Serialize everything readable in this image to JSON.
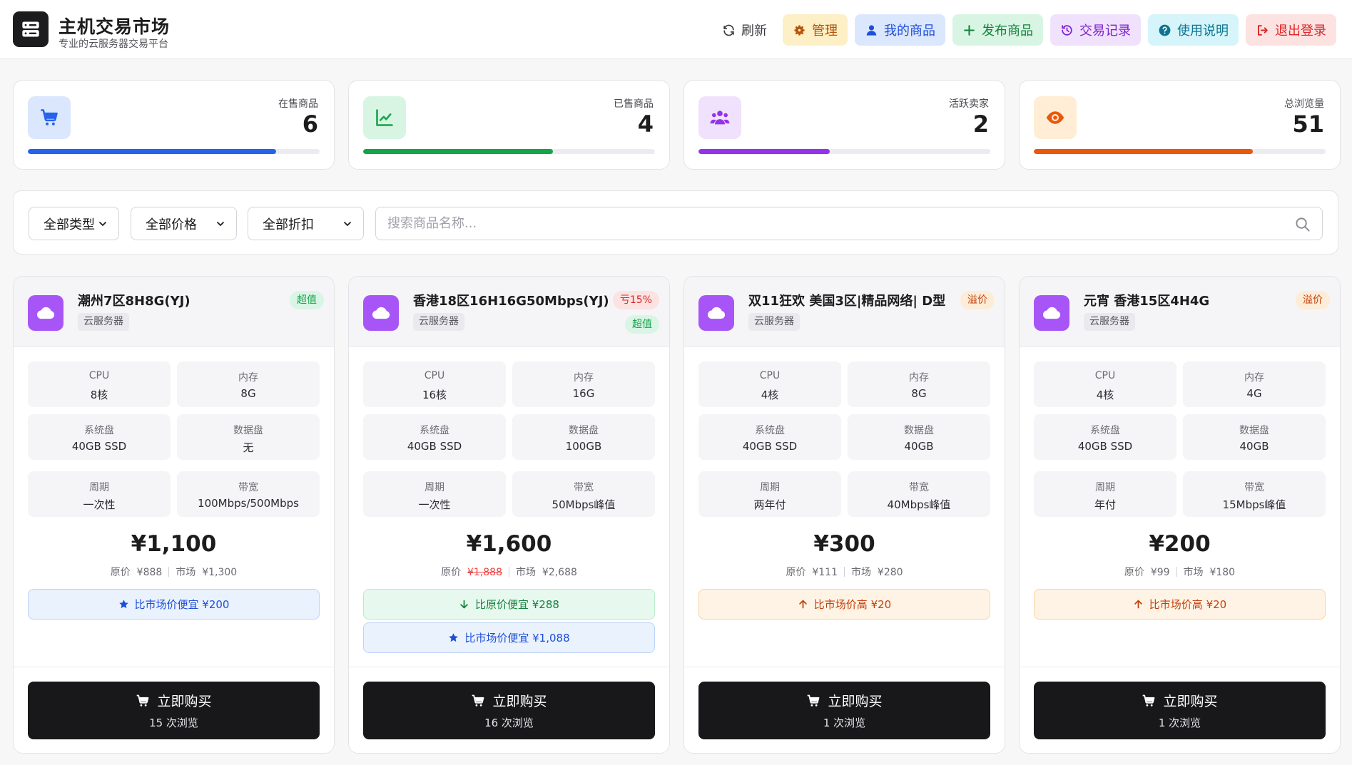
{
  "header": {
    "title": "主机交易市场",
    "subtitle": "专业的云服务器交易平台",
    "nav": [
      {
        "label": "刷新",
        "icon": "refresh-icon"
      },
      {
        "label": "管理",
        "icon": "gear-icon"
      },
      {
        "label": "我的商品",
        "icon": "user-icon"
      },
      {
        "label": "发布商品",
        "icon": "plus-icon"
      },
      {
        "label": "交易记录",
        "icon": "history-icon"
      },
      {
        "label": "使用说明",
        "icon": "question-circle-icon"
      },
      {
        "label": "退出登录",
        "icon": "logout-icon"
      }
    ]
  },
  "stats": [
    {
      "label": "在售商品",
      "value": "6",
      "progress": 0.85,
      "icon": "cart-icon",
      "color": "#2563eb",
      "bg": "#dbe7fd"
    },
    {
      "label": "已售商品",
      "value": "4",
      "progress": 0.65,
      "icon": "chart-line-icon",
      "color": "#16a34a",
      "bg": "#d8f5e3"
    },
    {
      "label": "活跃卖家",
      "value": "2",
      "progress": 0.45,
      "icon": "users-icon",
      "color": "#9333ea",
      "bg": "#f0e2fc"
    },
    {
      "label": "总浏览量",
      "value": "51",
      "progress": 0.75,
      "icon": "eye-icon",
      "color": "#ea580c",
      "bg": "#ffedd5"
    }
  ],
  "filters": {
    "type": "全部类型",
    "price": "全部价格",
    "discount": "全部折扣",
    "search_placeholder": "搜索商品名称..."
  },
  "spec_labels": {
    "cpu": "CPU",
    "mem": "内存",
    "sys": "系统盘",
    "data": "数据盘",
    "cycle": "周期",
    "bw": "带宽"
  },
  "buy_label": "立即购买",
  "products": [
    {
      "name": "潮州7区8H8G(YJ)",
      "type": "云服务器",
      "badges": [
        {
          "text": "超值",
          "style": "green"
        }
      ],
      "cpu": "8核",
      "mem": "8G",
      "sys": "40GB SSD",
      "data": "无",
      "cycle": "一次性",
      "bw": "100Mbps/500Mbps",
      "price": "¥1,100",
      "orig_label": "原价",
      "orig": "¥888",
      "orig_struck": false,
      "market_label": "市场",
      "market": "¥1,300",
      "notes": [
        {
          "text": "比市场价便宜 ¥200",
          "style": "blue",
          "icon": "star-icon"
        }
      ],
      "views": "15 次浏览"
    },
    {
      "name": "香港18区16H16G50Mbps(YJ)",
      "type": "云服务器",
      "badges": [
        {
          "text": "亏15%",
          "style": "red"
        },
        {
          "text": "超值",
          "style": "green"
        }
      ],
      "cpu": "16核",
      "mem": "16G",
      "sys": "40GB SSD",
      "data": "100GB",
      "cycle": "一次性",
      "bw": "50Mbps峰值",
      "price": "¥1,600",
      "orig_label": "原价",
      "orig": "¥1,888",
      "orig_struck": true,
      "market_label": "市场",
      "market": "¥2,688",
      "notes": [
        {
          "text": "比原价便宜 ¥288",
          "style": "green",
          "icon": "arrow-down-icon"
        },
        {
          "text": "比市场价便宜 ¥1,088",
          "style": "blue",
          "icon": "star-icon"
        }
      ],
      "views": "16 次浏览"
    },
    {
      "name": "双11狂欢 美国3区|精品网络| D型",
      "type": "云服务器",
      "badges": [
        {
          "text": "溢价",
          "style": "orange"
        }
      ],
      "cpu": "4核",
      "mem": "8G",
      "sys": "40GB SSD",
      "data": "40GB",
      "cycle": "两年付",
      "bw": "40Mbps峰值",
      "price": "¥300",
      "orig_label": "原价",
      "orig": "¥111",
      "orig_struck": false,
      "market_label": "市场",
      "market": "¥280",
      "notes": [
        {
          "text": "比市场价高 ¥20",
          "style": "orange",
          "icon": "arrow-up-icon"
        }
      ],
      "views": "1 次浏览"
    },
    {
      "name": "元宵 香港15区4H4G",
      "type": "云服务器",
      "badges": [
        {
          "text": "溢价",
          "style": "orange"
        }
      ],
      "cpu": "4核",
      "mem": "4G",
      "sys": "40GB SSD",
      "data": "40GB",
      "cycle": "年付",
      "bw": "15Mbps峰值",
      "price": "¥200",
      "orig_label": "原价",
      "orig": "¥99",
      "orig_struck": false,
      "market_label": "市场",
      "market": "¥180",
      "notes": [
        {
          "text": "比市场价高 ¥20",
          "style": "orange",
          "icon": "arrow-up-icon"
        }
      ],
      "views": "1 次浏览"
    }
  ]
}
